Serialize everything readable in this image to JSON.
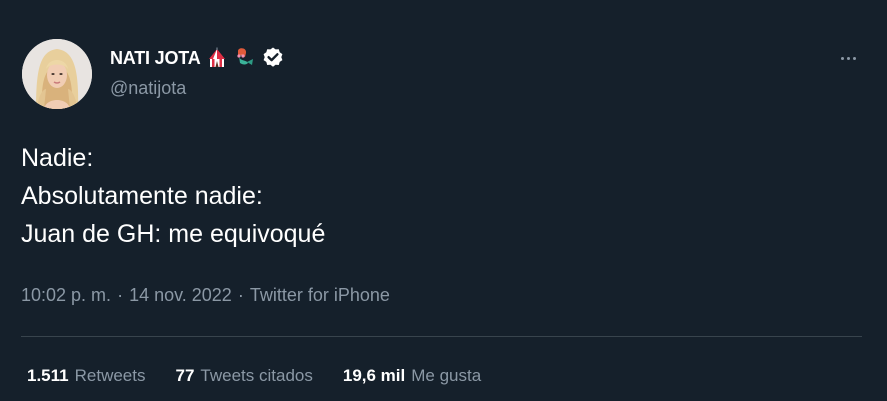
{
  "author": {
    "display_name": "NATI JOTA",
    "handle": "@natijota",
    "name_emojis": [
      "circus-tent-emoji",
      "mermaid-emoji"
    ],
    "verified": true
  },
  "tweet": {
    "lines": [
      "Nadie:",
      "Absolutamente nadie:",
      "Juan de GH: me equivoqué"
    ]
  },
  "meta": {
    "time": "10:02 p. m.",
    "separator": "·",
    "date": "14 nov. 2022",
    "source": "Twitter for iPhone"
  },
  "stats": {
    "retweets": {
      "count": "1.511",
      "label": "Retweets"
    },
    "quotes": {
      "count": "77",
      "label": "Tweets citados"
    },
    "likes": {
      "count": "19,6 mil",
      "label": "Me gusta"
    }
  },
  "colors": {
    "background": "#15202b",
    "secondary_text": "#8b98a5",
    "divider": "#38444d"
  }
}
